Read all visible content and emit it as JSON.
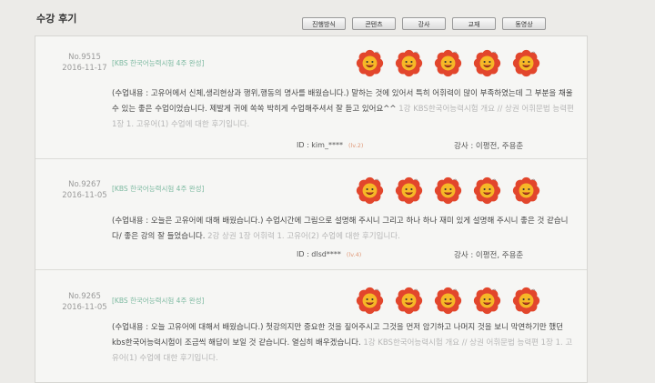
{
  "page": {
    "title": "수강 후기"
  },
  "tabs": [
    "진행방식",
    "콘텐츠",
    "강사",
    "교재",
    "동영상"
  ],
  "reviews": [
    {
      "no": "No.9515",
      "date": "2016-11-17",
      "course": "[KBS 한국어능력시험 4주 완성]",
      "rating": 5,
      "content": "(수업내용 : 고유어에서 신체,생리현상과 행위,행동의 명사를 배웠습니다.) 말하는 것에 있어서 특히 어휘력이 많이 부족하였는데 그 부분을 채울 수 있는 좋은 수업이었습니다. 제발게 귀에 쏙쏙 박히게 수업해주셔서 잘 듣고 있어요^^",
      "related": "1강 KBS한국어능력시험 개요 // 상권 어휘문법 능력편 1장 1. 고유어(1) 수업에 대한 후기입니다.",
      "user": "ID : kim_****",
      "level": "(lv.2)",
      "teacher": "강사 : 이평전, 주용춘"
    },
    {
      "no": "No.9267",
      "date": "2016-11-05",
      "course": "[KBS 한국어능력시험 4주 완성]",
      "rating": 5,
      "content": "(수업내용 : 오늘은 고유어에 대해 배웠습니다.) 수업시간에 그림으로 설명해 주시니 그리고 하나 하나 재미 있게 설명해 주시니 좋은 것 같습니다/ 좋은 강의 잘 들었습니다.",
      "related": "2강 상권 1장 어휘력 1. 고유어(2) 수업에 대한 후기입니다.",
      "user": "ID : dlsd****",
      "level": "(lv.4)",
      "teacher": "강사 : 이평전, 주용춘"
    },
    {
      "no": "No.9265",
      "date": "2016-11-05",
      "course": "[KBS 한국어능력시험 4주 완성]",
      "rating": 5,
      "content": "(수업내용 : 오늘 고유어에 대해서 배웠습니다.) 첫강의지만 중요한 것을 짚어주시고 그것을 먼저 암기하고 나머지 것을 보니 막연하기만 했던 kbs한국어능력시험이 조금씩 해답이 보일 것 같습니다. 열심히 배우겠습니다.",
      "related": "1강 KBS한국어능력시험 개요 // 상권 어휘문법 능력편 1장 1. 고유어(1) 수업에 대한 후기입니다.",
      "user": "",
      "level": "",
      "teacher": ""
    }
  ],
  "colors": {
    "background": "#ecebe8",
    "panel": "#f6f6f4",
    "course": "#7cb9a0",
    "flower_petal": "#e2462c",
    "flower_face": "#f6b827"
  },
  "icons": {
    "rating": "flower-smile-icon"
  }
}
